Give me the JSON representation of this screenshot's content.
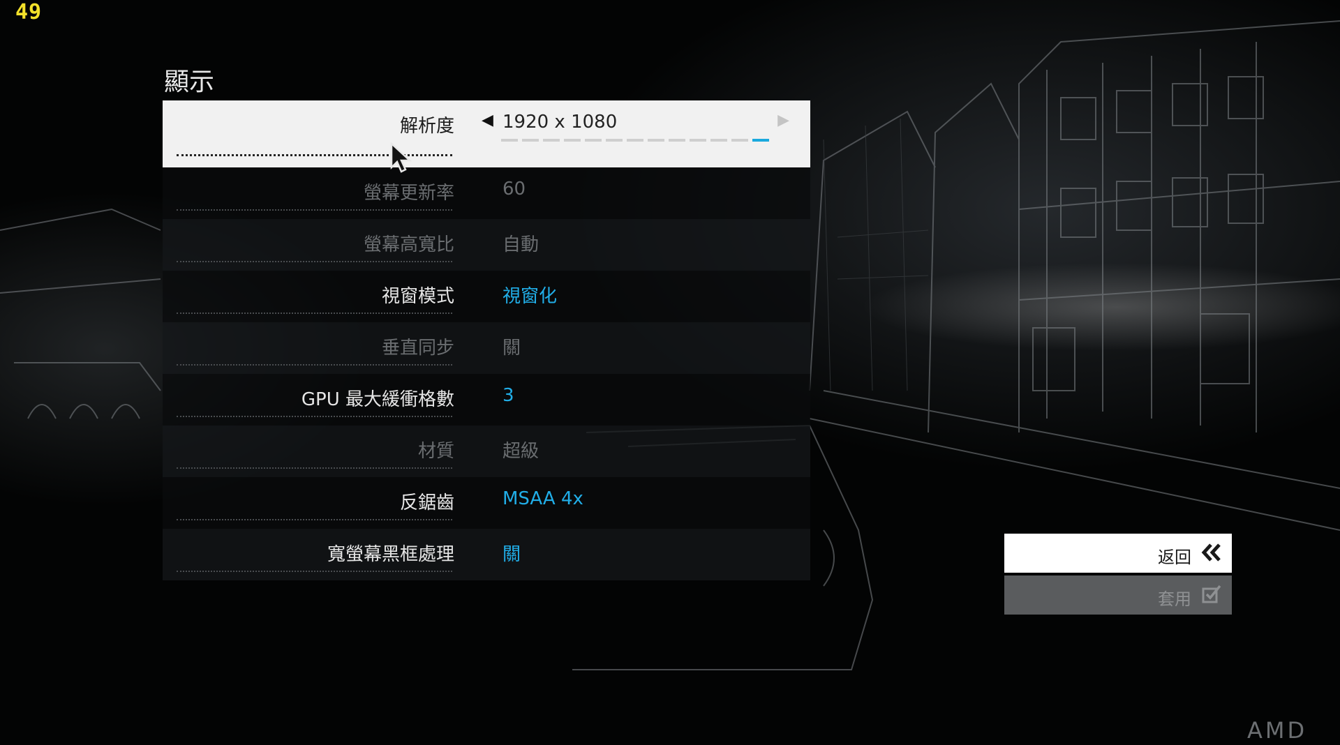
{
  "hud": {
    "fps": "49"
  },
  "section_title": "顯示",
  "settings": [
    {
      "label": "解析度",
      "value": "1920 x 1080",
      "state": "active",
      "steps_total": 13,
      "steps_selected": 13
    },
    {
      "label": "螢幕更新率",
      "value": "60",
      "state": "disabled"
    },
    {
      "label": "螢幕高寬比",
      "value": "自動",
      "state": "disabled"
    },
    {
      "label": "視窗模式",
      "value": "視窗化",
      "state": "enabled"
    },
    {
      "label": "垂直同步",
      "value": "關",
      "state": "disabled"
    },
    {
      "label": "GPU 最大緩衝格數",
      "value": "3",
      "state": "enabled"
    },
    {
      "label": "材質",
      "value": "超級",
      "state": "disabled"
    },
    {
      "label": "反鋸齒",
      "value": "MSAA 4x",
      "state": "enabled"
    },
    {
      "label": "寬螢幕黑框處理",
      "value": "關",
      "state": "enabled"
    }
  ],
  "buttons": {
    "back": {
      "label": "返回",
      "icon": "double-chevron-left-icon"
    },
    "apply": {
      "label": "套用",
      "icon": "checkbox-icon"
    }
  },
  "watermark": "AMD",
  "colors": {
    "accent": "#21aee8",
    "fps": "#f3e12a",
    "disabled": "#6a6d70",
    "active_row": "#f1f1f1"
  }
}
